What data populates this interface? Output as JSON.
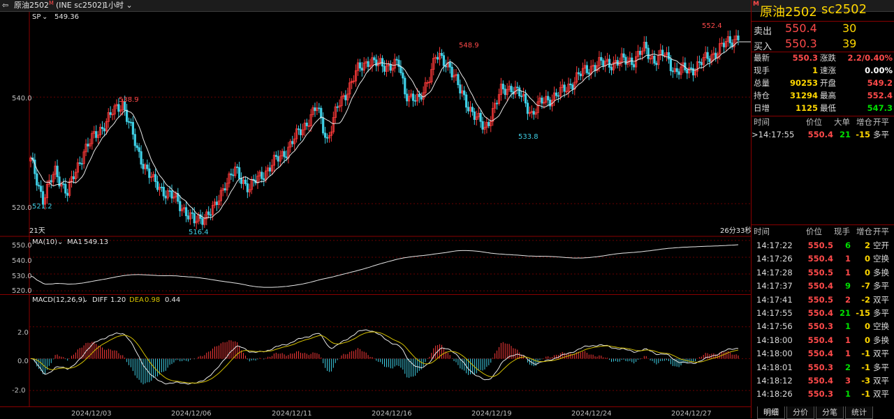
{
  "topbar": {
    "product": "原油2502",
    "product_suffix": "M",
    "code": "(INE sc2502)",
    "period": "1小时"
  },
  "main_panel": {
    "indicator": "SP",
    "value": "549.36",
    "period_label": "21天",
    "countdown": "26分33秒",
    "y_ticks": [
      "540.0",
      "520.0"
    ],
    "annotations": [
      "538.9",
      "548.9",
      "552.4",
      "521.2",
      "516.4",
      "533.8"
    ]
  },
  "ma_panel": {
    "indicator": "MA(10)",
    "series_label": "MA1",
    "series_value": "549.13",
    "y_ticks": [
      "550.0",
      "540.0",
      "530.0",
      "520.0"
    ]
  },
  "macd_panel": {
    "indicator": "MACD(12,26,9)",
    "diff_label": "DIFF",
    "diff_value": "1.20",
    "dea_label": "DEA",
    "dea_value": "0.98",
    "macd_value": "0.44",
    "y_ticks": [
      "2.0",
      "0.0",
      "-2.0"
    ]
  },
  "x_axis": [
    "2024/12/03",
    "2024/12/06",
    "2024/12/11",
    "2024/12/16",
    "2024/12/19",
    "2024/12/24",
    "2024/12/27"
  ],
  "colors": {
    "up": "#ff3a3a",
    "down": "#3fd0e6",
    "ma": "#e8e8e8",
    "dea": "#d4c000"
  },
  "chart_data": {
    "type": "candlestick",
    "title": "",
    "price_range": [
      514,
      556
    ],
    "ma_range": [
      518,
      552
    ],
    "macd_range": [
      -3,
      4
    ],
    "marked_high": 552.4,
    "marked_low": 516.4,
    "close_last": 549.36,
    "macd_diff": 1.2,
    "macd_dea": 0.98,
    "macd_hist": 0.44,
    "grid": false
  },
  "quote": {
    "title": "原油2502",
    "code": "sc2502",
    "m_mark": "M",
    "sell_label": "卖出",
    "sell_price": "550.4",
    "sell_vol": "30",
    "buy_label": "买入",
    "buy_price": "550.3",
    "buy_vol": "39",
    "stats": [
      {
        "l1": "最新",
        "v1": "550.3",
        "l2": "涨跌",
        "v2": "2.2/0.40%"
      },
      {
        "l1": "现手",
        "v1": "1",
        "l2": "速涨",
        "v2": "0.00%"
      },
      {
        "l1": "总量",
        "v1": "90253",
        "l2": "开盘",
        "v2": "549.2"
      },
      {
        "l1": "持仓",
        "v1": "31294",
        "l2": "最高",
        "v2": "552.4"
      },
      {
        "l1": "日增",
        "v1": "1125",
        "l2": "最低",
        "v2": "547.3"
      }
    ],
    "big_header": [
      "时间",
      "价位",
      "大单",
      "增仓",
      "开平"
    ],
    "big_rows": [
      {
        "time": ">14:17:55",
        "price": "550.4",
        "vol": "21",
        "inc": "-15",
        "type": "多平"
      }
    ],
    "tick_header": [
      "时间",
      "价位",
      "现手",
      "增仓",
      "开平"
    ],
    "ticks": [
      {
        "time": "14:17:22",
        "price": "550.5",
        "vol": "6",
        "inc": "2",
        "type": "空开"
      },
      {
        "time": "14:17:26",
        "price": "550.4",
        "vol": "1",
        "inc": "0",
        "type": "空换"
      },
      {
        "time": "14:17:28",
        "price": "550.5",
        "vol": "1",
        "inc": "0",
        "type": "多换"
      },
      {
        "time": "14:17:37",
        "price": "550.4",
        "vol": "9",
        "inc": "-7",
        "type": "多平"
      },
      {
        "time": "14:17:41",
        "price": "550.5",
        "vol": "2",
        "inc": "-2",
        "type": "双平"
      },
      {
        "time": "14:17:55",
        "price": "550.4",
        "vol": "21",
        "inc": "-15",
        "type": "多平"
      },
      {
        "time": "14:17:56",
        "price": "550.3",
        "vol": "1",
        "inc": "0",
        "type": "空换"
      },
      {
        "time": "14:18:00",
        "price": "550.4",
        "vol": "1",
        "inc": "0",
        "type": "多换"
      },
      {
        "time": "14:18:00",
        "price": "550.4",
        "vol": "1",
        "inc": "-1",
        "type": "双平"
      },
      {
        "time": "14:18:01",
        "price": "550.3",
        "vol": "2",
        "inc": "-1",
        "type": "多平"
      },
      {
        "time": "14:18:12",
        "price": "550.4",
        "vol": "3",
        "inc": "-3",
        "type": "双平"
      },
      {
        "time": "14:18:26",
        "price": "550.3",
        "vol": "1",
        "inc": "-1",
        "type": "双平"
      }
    ],
    "tabs": [
      "明细",
      "分价",
      "分笔",
      "统计"
    ]
  }
}
